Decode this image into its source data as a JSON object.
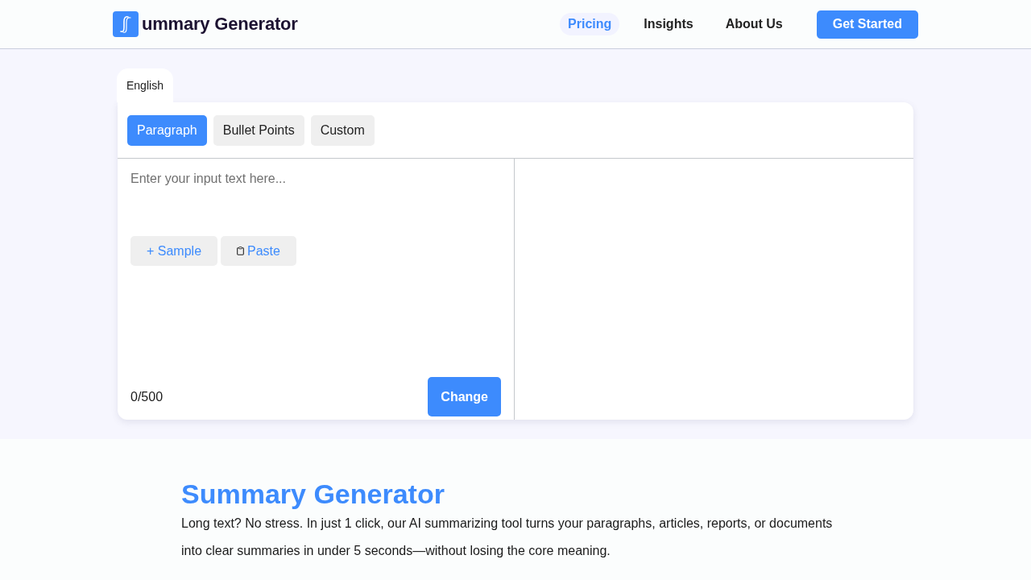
{
  "header": {
    "logo_text": "ummary Generator",
    "nav": [
      {
        "label": "Pricing",
        "selected": true
      },
      {
        "label": "Insights",
        "selected": false
      },
      {
        "label": "About Us",
        "selected": false
      }
    ],
    "cta": "Get Started"
  },
  "language_tabs": [
    {
      "label": "English",
      "selected": true
    }
  ],
  "mode_tabs": [
    {
      "label": "Paragraph",
      "selected": true
    },
    {
      "label": "Bullet Points",
      "selected": false
    },
    {
      "label": "Custom",
      "selected": false
    }
  ],
  "input": {
    "placeholder": "Enter your input text here...",
    "actions": [
      {
        "label": "+ Sample",
        "kind": "sample"
      },
      {
        "label": "Paste",
        "kind": "paste"
      }
    ],
    "counter": "0/500",
    "submit": "Change"
  },
  "intro": {
    "title": "Summary Generator",
    "text": "Long text? No stress. In just 1 click, our AI summarizing tool turns your paragraphs, articles, reports, or documents into clear summaries in under 5 seconds—without losing the core meaning."
  }
}
